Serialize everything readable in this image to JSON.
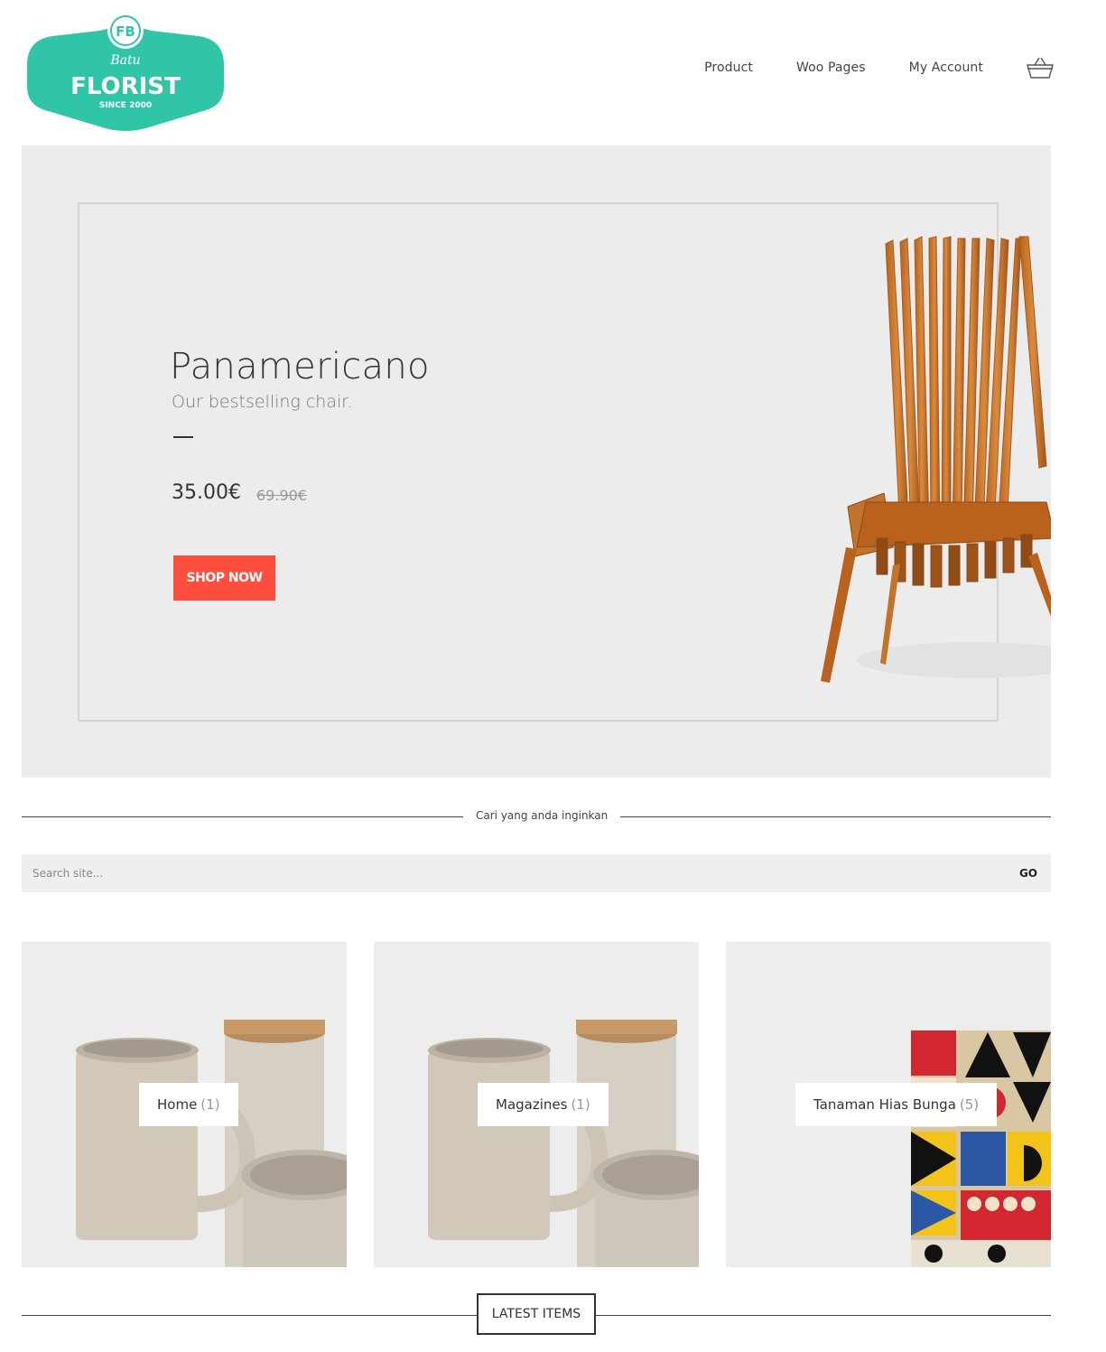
{
  "logo": {
    "initials": "FB",
    "script": "Batu",
    "name": "FLORIST",
    "since": "SINCE 2000",
    "color": "#2fc5a6"
  },
  "nav": {
    "items": [
      "Product",
      "Woo Pages",
      "My Account"
    ],
    "cart_icon": "basket-icon"
  },
  "hero": {
    "title": "Panamericano",
    "subtitle": "Our bestselling chair.",
    "price": "35.00€",
    "old_price": "69.90€",
    "button": "SHOP NOW",
    "button_color": "#ff4e3d"
  },
  "search_section": {
    "label": "Cari yang anda inginkan",
    "placeholder": "Search site...",
    "button": "GO"
  },
  "categories": [
    {
      "name": "Home",
      "count": "(1)"
    },
    {
      "name": "Magazines",
      "count": "(1)"
    },
    {
      "name": "Tanaman Hias Bunga",
      "count": "(5)"
    }
  ],
  "latest": {
    "label": "LATEST ITEMS"
  }
}
